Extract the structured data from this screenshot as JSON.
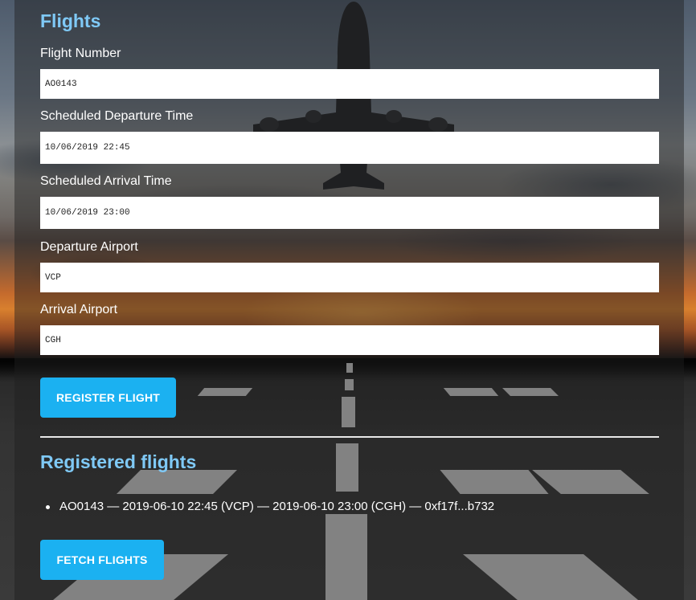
{
  "form": {
    "title": "Flights",
    "fields": [
      {
        "label": "Flight Number",
        "value": "AO0143"
      },
      {
        "label": "Scheduled Departure Time",
        "value": "10/06/2019 22:45"
      },
      {
        "label": "Scheduled Arrival Time",
        "value": "10/06/2019 23:00"
      },
      {
        "label": "Departure Airport",
        "value": "VCP"
      },
      {
        "label": "Arrival Airport",
        "value": "CGH"
      }
    ],
    "register_label": "REGISTER FLIGHT"
  },
  "registered": {
    "title": "Registered flights",
    "items": [
      "AO0143 — 2019-06-10 22:45 (VCP) — 2019-06-10 23:00 (CGH) — 0xf17f...b732"
    ],
    "fetch_label": "FETCH FLIGHTS"
  },
  "colors": {
    "accent": "#1bb1f1",
    "heading": "#7fc9f6"
  }
}
